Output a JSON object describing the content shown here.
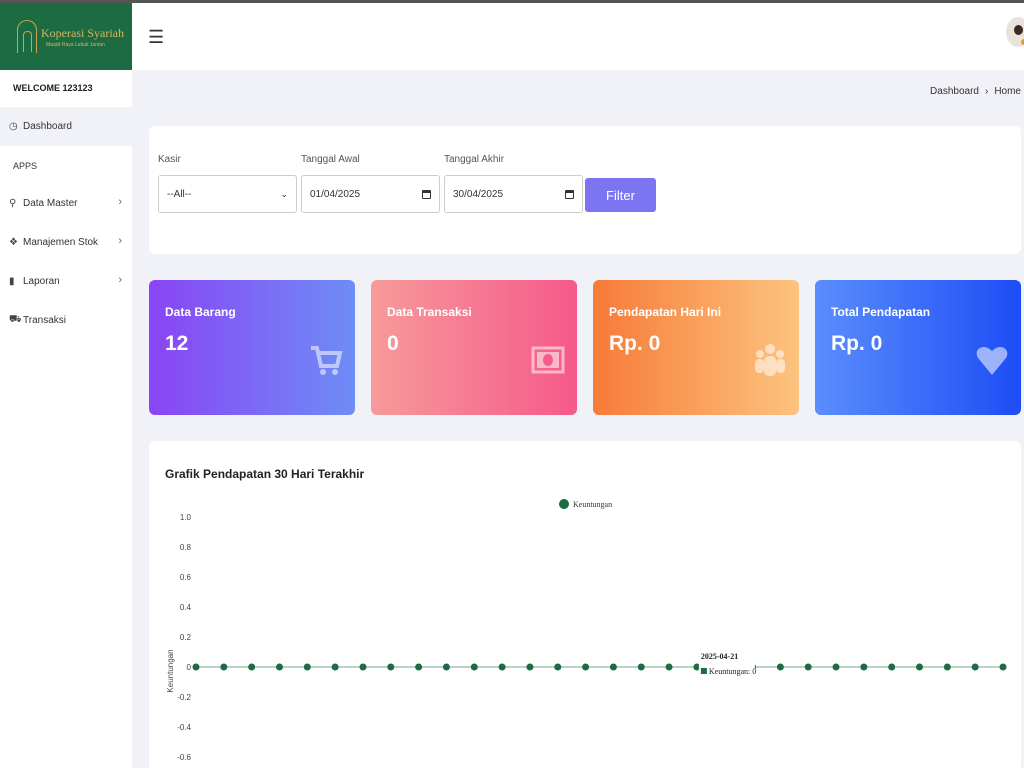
{
  "brand": {
    "title": "Koperasi Syariah",
    "subtitle": "Masjid Raya Lubuk Jantan",
    "color": "#1d6b43"
  },
  "sidebar": {
    "welcome": "WELCOME 123123",
    "apps_heading": "APPS",
    "items": [
      {
        "label": "Dashboard",
        "icon": "dashboard-gauge-icon",
        "active": true
      },
      {
        "label": "Data Master",
        "icon": "lightbulb-icon",
        "chevron": true
      },
      {
        "label": "Manajemen Stok",
        "icon": "cubes-icon",
        "chevron": true
      },
      {
        "label": "Laporan",
        "icon": "file-icon",
        "chevron": true
      },
      {
        "label": "Transaksi",
        "icon": "cart-icon"
      }
    ]
  },
  "breadcrumb": {
    "current": "Dashboard",
    "home": "Home"
  },
  "filter": {
    "kasir_label": "Kasir",
    "kasir_value": "--All--",
    "tanggal_awal_label": "Tanggal Awal",
    "tanggal_awal_value": "01/04/2025",
    "tanggal_akhir_label": "Tanggal Akhir",
    "tanggal_akhir_value": "30/04/2025",
    "button_label": "Filter"
  },
  "stats": [
    {
      "title": "Data Barang",
      "value": "12",
      "icon": "cart-icon",
      "gradient": [
        "#8a44f5",
        "#6e8df5"
      ]
    },
    {
      "title": "Data Transaksi",
      "value": "0",
      "icon": "money-icon",
      "gradient": [
        "#f79a9a",
        "#f5598a"
      ]
    },
    {
      "title": "Pendapatan Hari Ini",
      "value": "Rp. 0",
      "icon": "users-icon",
      "gradient": [
        "#f77a38",
        "#fcc47f"
      ]
    },
    {
      "title": "Total Pendapatan",
      "value": "Rp. 0",
      "icon": "heart-icon",
      "gradient": [
        "#5b8dfc",
        "#1d4df5"
      ]
    }
  ],
  "chart": {
    "title": "Grafik Pendapatan 30 Hari Terakhir",
    "tooltip_date": "2025-04-21",
    "tooltip_value": "Keuntungan: 0"
  },
  "chart_data": {
    "type": "line",
    "title": "Grafik Pendapatan 30 Hari Terakhir",
    "ylabel": "Keuntungan",
    "xlabel": "",
    "legend": "top-center",
    "series_color": "#1d6b43",
    "yticks": [
      1.0,
      0.8,
      0.6,
      0.4,
      0.2,
      0,
      -0.2,
      -0.4,
      -0.6
    ],
    "yticklabels": [
      "1.0",
      "0.8",
      "0.6",
      "0.4",
      "0.2",
      "0",
      "-0.2",
      "-0.4",
      "-0.6"
    ],
    "ylim": [
      -0.6,
      1.0
    ],
    "series": [
      {
        "name": "Keuntungan",
        "values": [
          0,
          0,
          0,
          0,
          0,
          0,
          0,
          0,
          0,
          0,
          0,
          0,
          0,
          0,
          0,
          0,
          0,
          0,
          0,
          0,
          0,
          0,
          0,
          0,
          0,
          0,
          0,
          0,
          0,
          0
        ]
      }
    ]
  }
}
